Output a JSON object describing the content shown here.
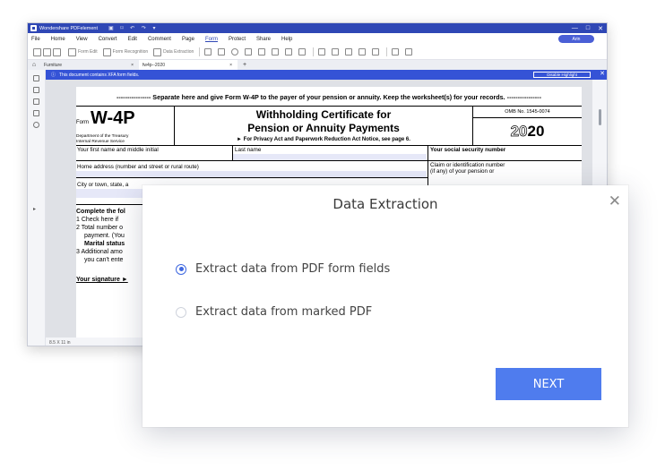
{
  "app": {
    "title": "Wondershare PDFelement",
    "window_controls": [
      "—",
      "□",
      "✕"
    ],
    "menu": [
      "File",
      "Home",
      "View",
      "Convert",
      "Edit",
      "Comment",
      "Page",
      "Form",
      "Protect",
      "Share",
      "Help"
    ],
    "active_menu": "Form",
    "user_label": "Arin",
    "toolbar": {
      "form_edit": "Form Edit",
      "form_recognition": "Form Recognition",
      "data_extraction": "Data Extraction"
    },
    "tabs": [
      {
        "label": "Furniture",
        "close": "×"
      },
      {
        "label": "fw4p--2020",
        "close": "×"
      }
    ],
    "new_tab": "+",
    "notice": {
      "text": "This document contains XFA form fields.",
      "button": "Disable Highlight",
      "close": "✕"
    },
    "status": "8.5 X 11 in"
  },
  "form": {
    "separator": "---------------- Separate here and give Form W-4P to the payer of your pension or annuity. Keep the worksheet(s) for your records. ----------------",
    "form_prefix": "Form",
    "form_id": "W-4P",
    "dept_line1": "Department of the Treasury",
    "dept_line2": "Internal Revenue Service",
    "title_line1": "Withholding Certificate for",
    "title_line2": "Pension or Annuity Payments",
    "privacy_note": "► For Privacy Act and Paperwork Reduction Act Notice, see page 6.",
    "omb": "OMB No. 1545-0074",
    "year_prefix": "20",
    "year_suffix": "20",
    "first_name": "Your first name and middle initial",
    "last_name": "Last name",
    "ssn": "Your social security number",
    "address": "Home address (number and street or rural route)",
    "claim_line1": "Claim or identification number",
    "claim_line2": "(if any) of your pension or",
    "city": "City or town, state, a",
    "instr_heading": "Complete the fol",
    "instr_1": "1  Check here if",
    "instr_2": "2  Total number o",
    "instr_2b": "payment. (You",
    "instr_2c": "Marital status",
    "instr_3": "3  Additional amo",
    "instr_3b": "you can't ente",
    "signature": "Your signature ►"
  },
  "dialog": {
    "title": "Data Extraction",
    "close": "✕",
    "options": [
      {
        "label": "Extract data from PDF form fields",
        "selected": true
      },
      {
        "label": "Extract data from marked PDF",
        "selected": false
      }
    ],
    "next_button": "NEXT"
  },
  "colors": {
    "accent": "#4f7cee",
    "titlebar": "#2f47b5",
    "notice": "#3553d6",
    "radio_checked": "#3f68e0"
  }
}
